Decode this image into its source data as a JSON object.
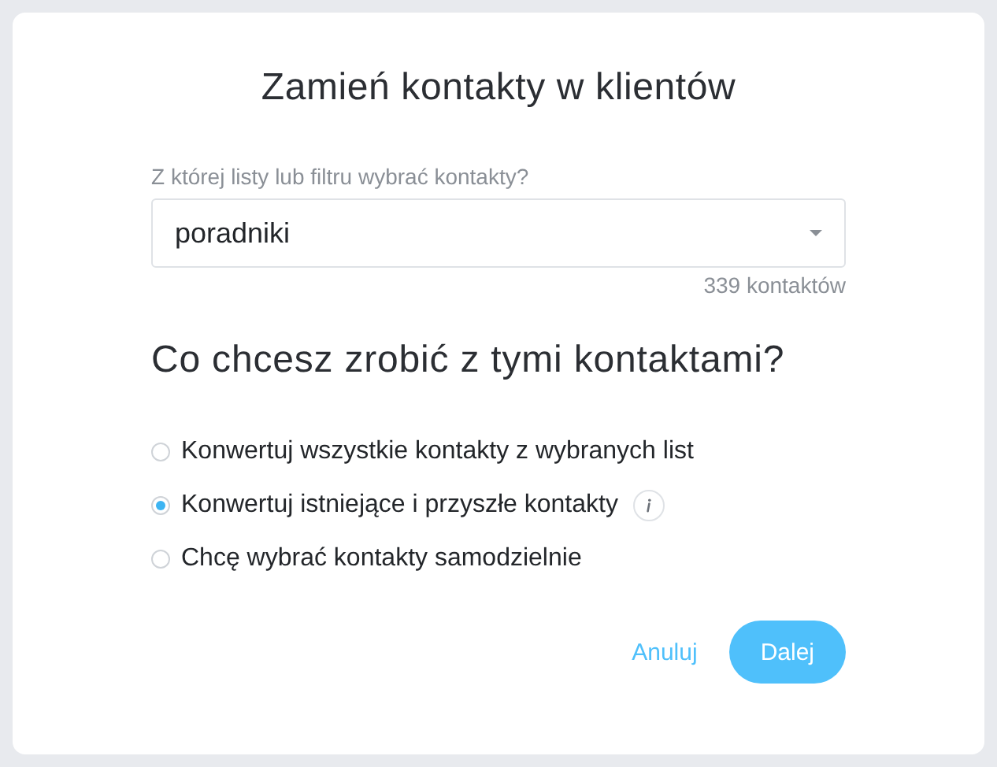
{
  "dialog": {
    "title": "Zamień kontakty w klientów",
    "source": {
      "label": "Z której listy lub filtru wybrać kontakty?",
      "value": "poradniki",
      "count": "339 kontaktów"
    },
    "question": "Co chcesz zrobić z tymi kontaktami?",
    "options": [
      {
        "label": "Konwertuj wszystkie kontakty z wybranych list",
        "selected": false,
        "info": false
      },
      {
        "label": "Konwertuj istniejące i przyszłe kontakty",
        "selected": true,
        "info": true
      },
      {
        "label": "Chcę wybrać kontakty samodzielnie",
        "selected": false,
        "info": false
      }
    ],
    "buttons": [
      {
        "label": "Anuluj",
        "kind": "link"
      },
      {
        "label": "Dalej",
        "kind": "primary"
      }
    ]
  }
}
